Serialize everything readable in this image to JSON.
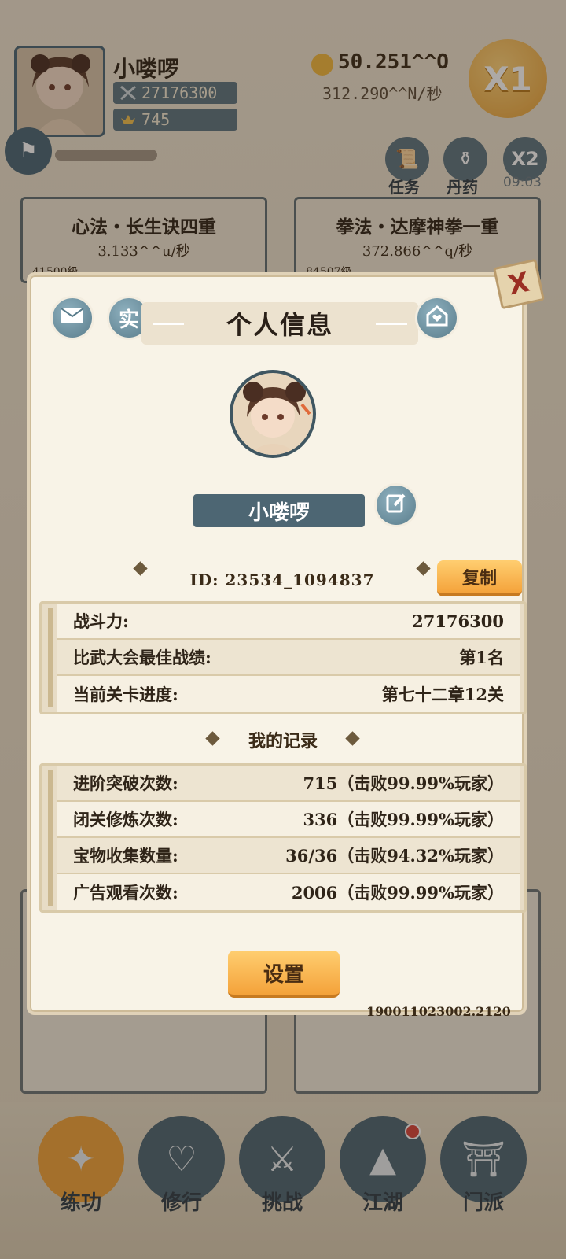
{
  "header": {
    "player_name": "小喽啰",
    "power": "27176300",
    "ingots": "745",
    "gold": "50.251^^O",
    "gold_rate": "312.290^^N/秒",
    "multiplier": "X1",
    "task_label": "任务",
    "elixir_label": "丹药",
    "x2_label": "X2",
    "x2_timer": "09:03"
  },
  "skills": [
    {
      "title": "心法・长生诀四重",
      "rate": "3.133^^u/秒",
      "level": "41500级"
    },
    {
      "title": "拳法・达摩神拳一重",
      "rate": "372.866^^q/秒",
      "level": "84507级"
    }
  ],
  "bottom_nav": [
    {
      "label": "练功",
      "icon": "martial-icon"
    },
    {
      "label": "修行",
      "icon": "heart-mind-icon"
    },
    {
      "label": "挑战",
      "icon": "crossed-swords-icon"
    },
    {
      "label": "江湖",
      "icon": "mountain-icon"
    },
    {
      "label": "门派",
      "icon": "gate-icon"
    }
  ],
  "dialog": {
    "title": "个人信息",
    "real_name_badge": "实",
    "close_symbol": "X",
    "name": "小喽啰",
    "id_text": "ID:  23534_1094837",
    "copy_label": "复制",
    "stats": [
      {
        "label": "战斗力:",
        "value": "27176300"
      },
      {
        "label": "比武大会最佳战绩:",
        "value": "第1名"
      },
      {
        "label": "当前关卡进度:",
        "value": "第七十二章12关"
      }
    ],
    "records_title": "我的记录",
    "records": [
      {
        "label": "进阶突破次数:",
        "value": "715（击败99.99%玩家）"
      },
      {
        "label": "闭关修炼次数:",
        "value": "336（击败99.99%玩家）"
      },
      {
        "label": "宝物收集数量:",
        "value": "36/36（击败94.32%玩家）"
      },
      {
        "label": "广告观看次数:",
        "value": "2006（击败99.99%玩家）"
      }
    ],
    "settings_label": "设置",
    "version": "190011023002.2120"
  }
}
